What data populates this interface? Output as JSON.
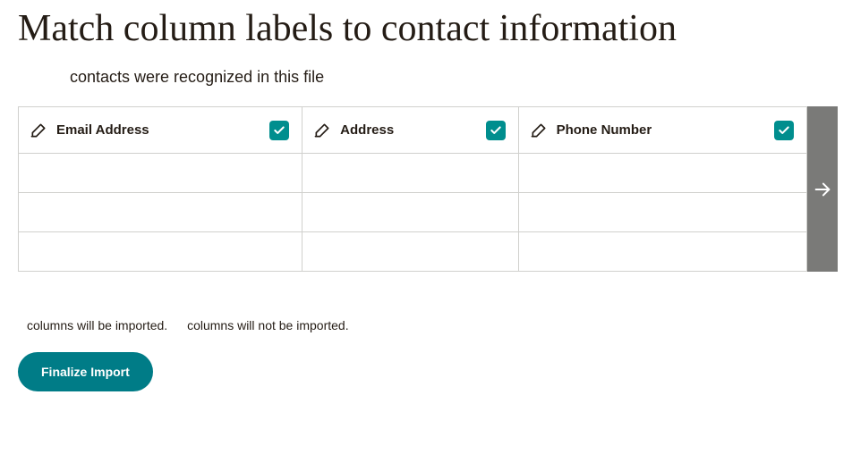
{
  "title": "Match column labels to contact information",
  "recognized_text": "contacts were recognized in this file",
  "columns": [
    {
      "label": "Email Address",
      "checked": true
    },
    {
      "label": "Address",
      "checked": true
    },
    {
      "label": "Phone Number",
      "checked": true
    }
  ],
  "summary": {
    "imported_text": "columns will be imported.",
    "not_imported_text": "columns will not be imported."
  },
  "finalize_label": "Finalize Import",
  "colors": {
    "accent": "#007c87",
    "checkbox": "#008e8e",
    "handle": "#7a7a78"
  }
}
